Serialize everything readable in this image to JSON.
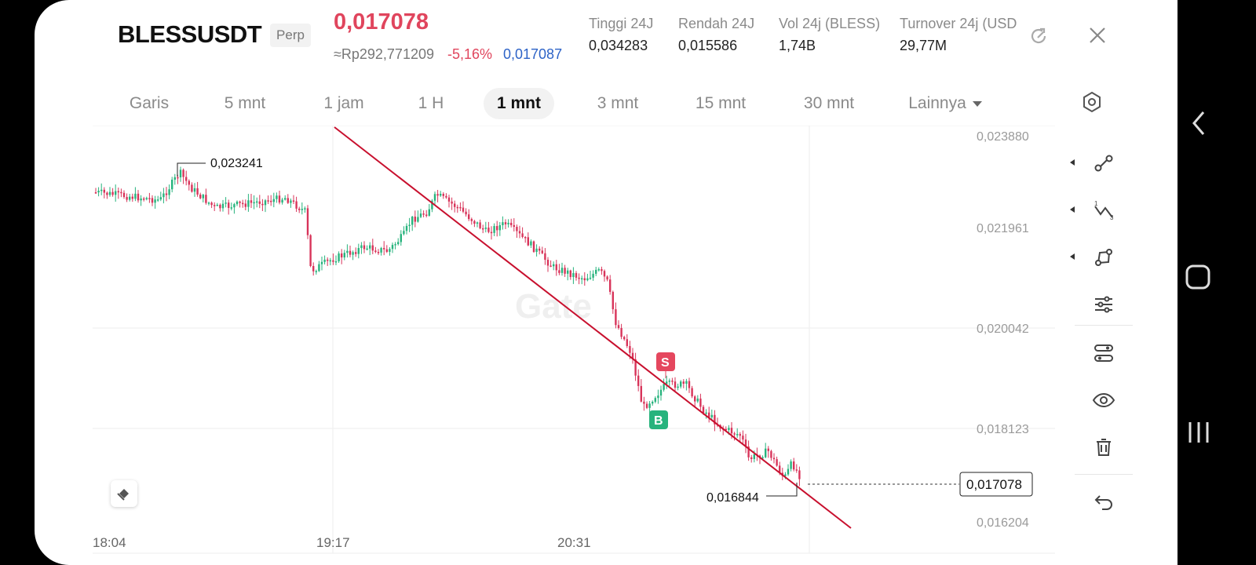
{
  "header": {
    "symbol": "BLESSUSDT",
    "badge": "Perp",
    "last_price": "0,017078",
    "converted_price": "≈Rp292,771209",
    "change_percent": "-5,16%",
    "mark_price": "0,017087",
    "stats": [
      {
        "label": "Tinggi 24J",
        "value": "0,034283"
      },
      {
        "label": "Rendah 24J",
        "value": "0,015586"
      },
      {
        "label": "Vol 24j (BLESS)",
        "value": "1,74B"
      },
      {
        "label": "Turnover 24j (USD",
        "value": "29,77M"
      }
    ],
    "icons": {
      "rotate": "rotate-screen-icon",
      "close": "close-icon"
    }
  },
  "tabs": [
    "Garis",
    "5 mnt",
    "1 jam",
    "1 H",
    "1 mnt",
    "3 mnt",
    "15 mnt",
    "30 mnt",
    "Lainnya"
  ],
  "active_tab": "1 mnt",
  "chart": {
    "y_labels": [
      "0,023880",
      "0,021961",
      "0,020042",
      "0,018123",
      "0,016204"
    ],
    "x_labels": [
      "18:04",
      "19:17",
      "20:31"
    ],
    "high_marker": "0,023241",
    "low_marker": "0,016844",
    "current_price": "0,017078",
    "sell_marker": "S",
    "buy_marker": "B",
    "watermark": "Gate",
    "colors": {
      "up": "#27b37d",
      "down": "#d8345a",
      "trendline": "#c8102e",
      "sell": "#e5475e",
      "buy": "#27b37d"
    }
  },
  "toolbar": [
    "line-tool-icon",
    "fibonacci-tool-icon",
    "shape-tool-icon",
    "indicator-settings-icon",
    "layers-icon",
    "visibility-icon",
    "delete-icon",
    "undo-icon"
  ],
  "system_nav": [
    "back-icon",
    "home-icon",
    "recents-icon"
  ]
}
